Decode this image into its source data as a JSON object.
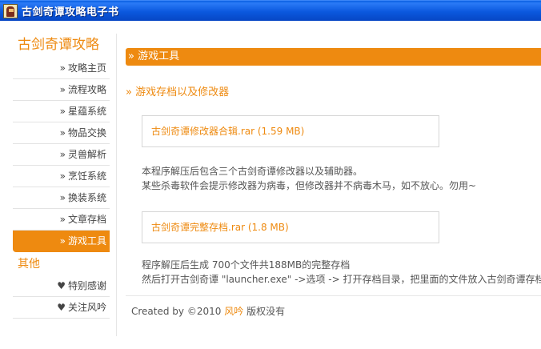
{
  "window": {
    "title": "古剑奇谭攻略电子书",
    "icon": "app-icon"
  },
  "sidebar": {
    "title": "古剑奇谭攻略",
    "items": [
      {
        "label": "攻略主页",
        "active": false
      },
      {
        "label": "流程攻略",
        "active": false
      },
      {
        "label": "星蕴系统",
        "active": false
      },
      {
        "label": "物品交换",
        "active": false
      },
      {
        "label": "灵兽解析",
        "active": false
      },
      {
        "label": "烹饪系统",
        "active": false
      },
      {
        "label": "换装系统",
        "active": false
      },
      {
        "label": "文章存档",
        "active": false
      },
      {
        "label": "游戏工具",
        "active": true
      }
    ],
    "arrow": "»",
    "other_title": "其他",
    "other_items": [
      {
        "label": "特别感谢",
        "bullet": "♥"
      },
      {
        "label": "关注风吟",
        "bullet": "♥"
      }
    ]
  },
  "main": {
    "section_title": "» 游戏工具",
    "subheading": "» 游戏存档以及修改器",
    "files": [
      {
        "link": "古剑奇谭修改器合辑.rar (1.59 MB)",
        "description": [
          "本程序解压后包含三个古剑奇谭修改器以及辅助器。",
          "某些杀毒软件会提示修改器为病毒，但修改器并不病毒木马，如不放心。勿用~"
        ]
      },
      {
        "link": "古剑奇谭完整存档.rar (1.8 MB)",
        "description": [
          "程序解压后生成 700个文件共188MB的完整存档",
          "然后打开古剑奇谭 \"launcher.exe\" ->选项 -> 打开存档目录，把里面的文件放入古剑奇谭存档"
        ]
      }
    ]
  },
  "footer": {
    "prefix": "Created by ©2010",
    "author": "风吟",
    "suffix": "版权没有"
  },
  "colors": {
    "accent": "#ee8a10",
    "titlebar": "#0b58de"
  }
}
